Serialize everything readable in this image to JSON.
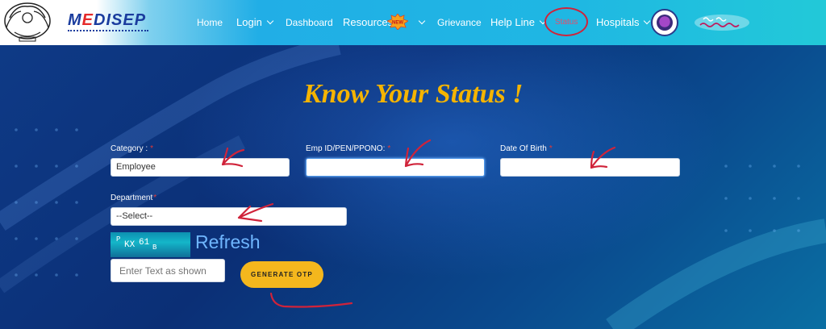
{
  "header": {
    "brand": {
      "prefix": "M",
      "accent": "E",
      "rest": "DISEP"
    },
    "nav": {
      "home": "Home",
      "login": "Login",
      "dashboard": "Dashboard",
      "resources": "Resources",
      "grievance": "Grievance",
      "helpline": "Help Line",
      "status": "Status",
      "hospitals": "Hospitals"
    },
    "badge_new": "NEW"
  },
  "main": {
    "heading": "Know Your Status !",
    "form": {
      "category": {
        "label": "Category :",
        "value": "Employee"
      },
      "empid": {
        "label": "Emp ID/PEN/PPONO:",
        "value": ""
      },
      "dob": {
        "label": "Date Of Birth",
        "value": ""
      },
      "department": {
        "label": "Department",
        "value": "--Select--"
      },
      "required_mark": "*"
    },
    "captcha": {
      "c1": "P",
      "c2": "KX",
      "c3": "61",
      "c4": "B"
    },
    "refresh_label": "Refresh",
    "captcha_placeholder": "Enter Text as shown",
    "generate_otp": "GENERATE OTP"
  },
  "colors": {
    "heading": "#f5b400",
    "button": "#f4b71d",
    "required": "#e53935",
    "annotation": "#d0233a",
    "refresh": "#6fb6ff"
  }
}
